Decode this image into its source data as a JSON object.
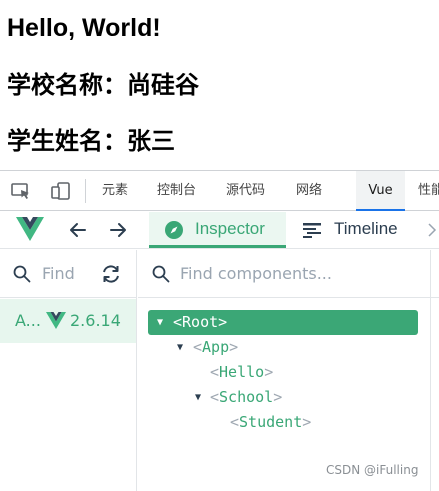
{
  "page": {
    "heading": "Hello, World!",
    "school_line": "学校名称：尚硅谷",
    "student_line": "学生姓名：张三"
  },
  "devtools_tabs": {
    "items": [
      "元素",
      "控制台",
      "源代码",
      "网络",
      "Vue",
      "性能"
    ],
    "active": "Vue"
  },
  "vue_devtools": {
    "tabs": {
      "inspector": "Inspector",
      "timeline": "Timeline"
    },
    "left_search_placeholder": "Find",
    "app": {
      "name": "A...",
      "version": "2.6.14"
    },
    "component_search_placeholder": "Find components...",
    "tree": [
      {
        "name": "Root",
        "expanded": true,
        "selected": true
      },
      {
        "name": "App",
        "expanded": true,
        "selected": false
      },
      {
        "name": "Hello",
        "expanded": false,
        "selected": false
      },
      {
        "name": "School",
        "expanded": true,
        "selected": false
      },
      {
        "name": "Student",
        "expanded": false,
        "selected": false
      }
    ]
  },
  "watermark": "CSDN @iFulling",
  "colors": {
    "vue_green": "#3aa776",
    "vue_dark": "#2c3e50",
    "chrome_active_blue": "#1a73e8"
  }
}
